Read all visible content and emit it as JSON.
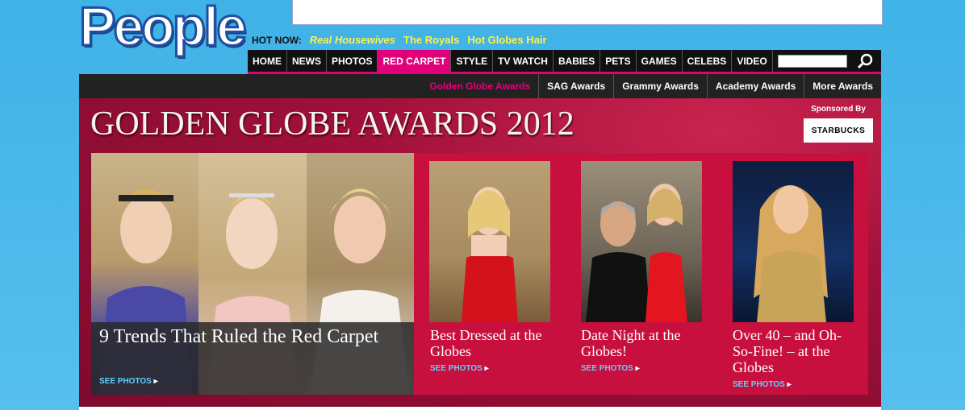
{
  "brand": {
    "logo_text": "People"
  },
  "hot_now": {
    "label": "HOT NOW:",
    "links": [
      "Real Housewives",
      "The Royals",
      "Hot Globes Hair"
    ]
  },
  "nav": {
    "items": [
      "HOME",
      "NEWS",
      "PHOTOS",
      "RED CARPET",
      "STYLE",
      "TV WATCH",
      "BABIES",
      "PETS",
      "GAMES",
      "CELEBS",
      "VIDEO"
    ],
    "active": "RED CARPET",
    "search_value": ""
  },
  "subnav": {
    "items": [
      "Golden Globe Awards",
      "SAG Awards",
      "Grammy Awards",
      "Academy Awards",
      "More Awards"
    ],
    "active": "Golden Globe Awards"
  },
  "hero": {
    "title": "GOLDEN GLOBE AWARDS 2012",
    "sponsored_by": "Sponsored By",
    "sponsor_name": "STARBUCKS"
  },
  "feature": {
    "headline": "9 Trends That Ruled the Red Carpet",
    "cta": "SEE PHOTOS"
  },
  "cards": [
    {
      "headline": "Best Dressed at the Globes",
      "cta": "SEE PHOTOS"
    },
    {
      "headline": "Date Night at the Globes!",
      "cta": "SEE PHOTOS"
    },
    {
      "headline": "Over 40 – and Oh-So-Fine! – at the Globes",
      "cta": "SEE PHOTOS"
    }
  ],
  "colors": {
    "accent": "#e2007a",
    "link_yellow": "#fff14f",
    "cta_blue": "#5fd0ff"
  }
}
